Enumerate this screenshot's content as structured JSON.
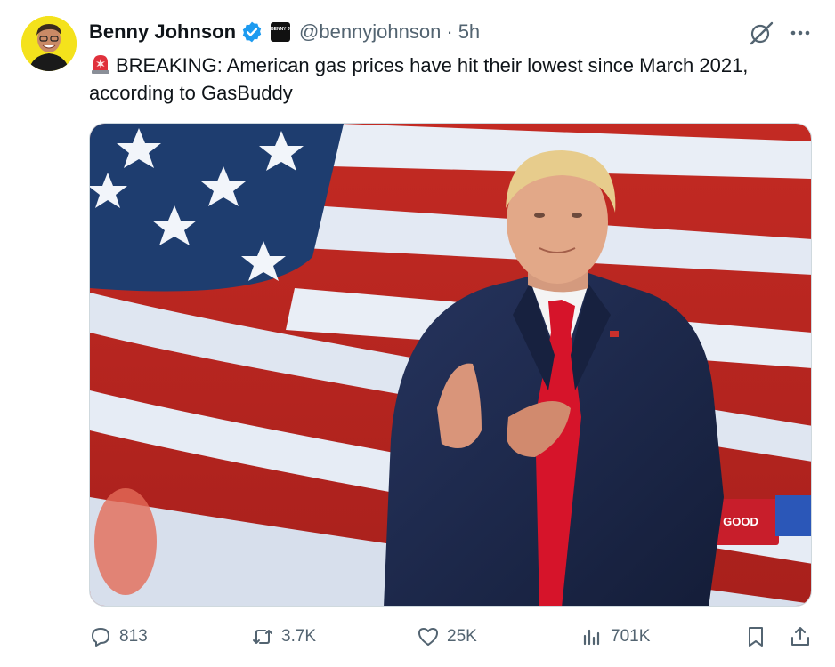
{
  "author": {
    "display_name": "Benny Johnson",
    "handle": "@bennyjohnson",
    "separator": "·",
    "time": "5h",
    "verified": true,
    "affiliation_badge": "BENNY JOHNSON"
  },
  "tweet": {
    "text": "BREAKING: American gas prices have hit their lowest since March 2021, according to GasBuddy",
    "leading_icon": "siren-icon"
  },
  "media": {
    "colors": {
      "flag_red": "#c8231f",
      "flag_white": "#e9eef6",
      "flag_blue": "#1f3f73",
      "suit": "#1d2a4f",
      "tie": "#d6142a"
    },
    "sign_text": "GOOD"
  },
  "actions": {
    "reply_count": "813",
    "repost_count": "3.7K",
    "like_count": "25K",
    "views_count": "701K"
  },
  "colors": {
    "verified_blue": "#1d9bf0",
    "secondary_text": "#536471",
    "primary_text": "#0f1419"
  }
}
